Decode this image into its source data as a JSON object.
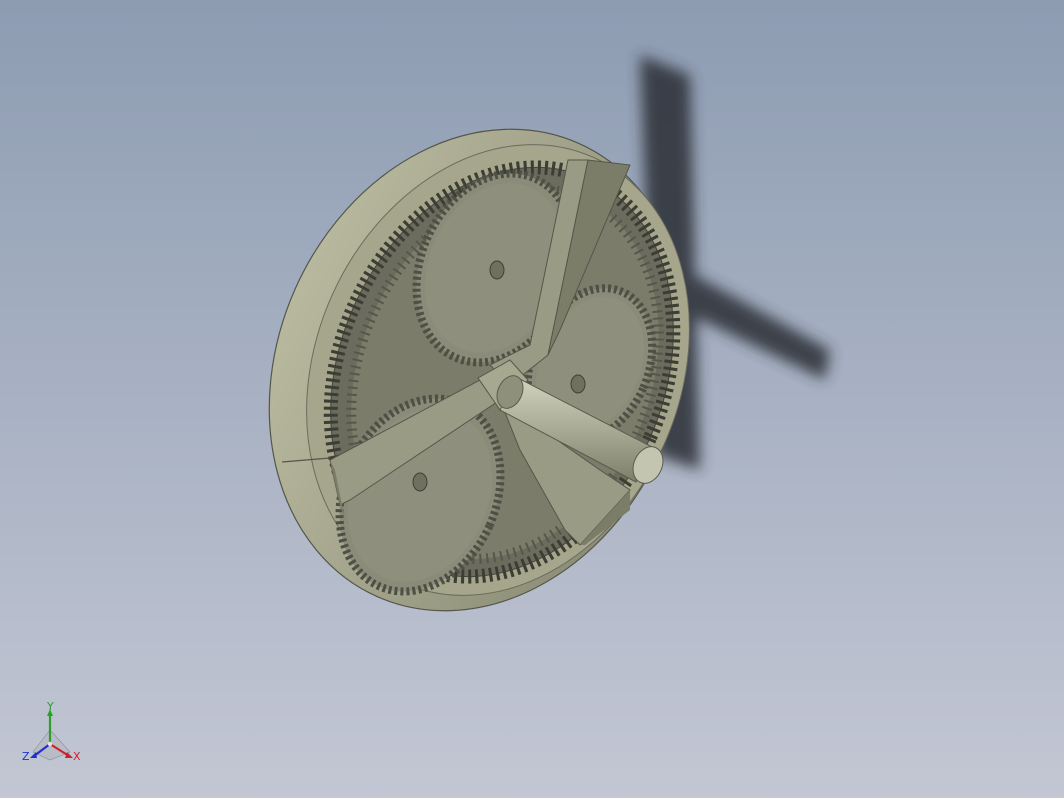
{
  "viewport": {
    "background_top": "#8d9cb2",
    "background_bottom": "#c3c7d4"
  },
  "model": {
    "ring_color": "#a3a48a",
    "ring_shade": "#7f8069",
    "gear_color": "#8a8b78",
    "gear_dark": "#4f5045",
    "carrier_color": "#9a9b84",
    "shaft_color": "#b0b19c",
    "shadow_color": "#2a2e36"
  },
  "triad": {
    "x_label": "X",
    "y_label": "Y",
    "z_label": "Z",
    "x_color": "#d0202a",
    "y_color": "#2aa02a",
    "z_color": "#2030d0"
  }
}
